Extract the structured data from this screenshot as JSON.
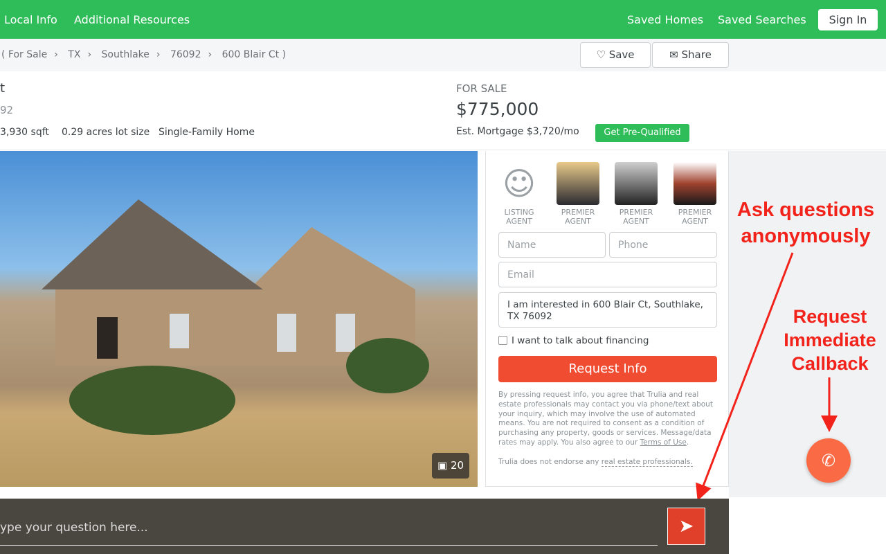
{
  "nav": {
    "local_info": "Local Info",
    "additional_resources": "Additional Resources",
    "saved_homes": "Saved Homes",
    "saved_searches": "Saved Searches",
    "sign_in": "Sign In"
  },
  "breadcrumb": [
    "( For Sale",
    "TX",
    "Southlake",
    "76092",
    "600 Blair Ct )"
  ],
  "actions": {
    "save": "Save",
    "share": "Share"
  },
  "listing": {
    "title_fragment": "t",
    "zip_fragment": "92",
    "sqft": "3,930 sqft",
    "lot": "0.29 acres lot size",
    "type": "Single-Family Home",
    "status": "FOR SALE",
    "price": "$775,000",
    "mortgage": "Est. Mortgage $3,720/mo",
    "prequal": "Get Pre-Qualified",
    "photo_count": "20"
  },
  "agents": [
    {
      "role1": "LISTING",
      "role2": "AGENT"
    },
    {
      "role1": "PREMIER",
      "role2": "AGENT"
    },
    {
      "role1": "PREMIER",
      "role2": "AGENT"
    },
    {
      "role1": "PREMIER",
      "role2": "AGENT"
    }
  ],
  "form": {
    "name_placeholder": "Name",
    "phone_placeholder": "Phone",
    "email_placeholder": "Email",
    "message": "I am interested in 600 Blair Ct, Southlake, TX 76092",
    "financing": "I want to talk about financing",
    "submit": "Request Info",
    "legal": "By pressing request info, you agree that Trulia and real estate professionals may contact you via phone/text about your inquiry, which may involve the use of automated means. You are not required to consent as a condition of purchasing any property, goods or services. Message/data rates may apply. You also agree to our ",
    "terms": "Terms of Use",
    "period": ".",
    "endorse": "Trulia does not endorse any ",
    "endorse_link": "real estate professionals."
  },
  "chat": {
    "placeholder": "ype your question here..."
  },
  "annotations": {
    "ask1": "Ask questions",
    "ask2": "anonymously",
    "cb1": "Request",
    "cb2": "Immediate",
    "cb3": "Callback"
  },
  "colors": {
    "brand": "#2ebd59",
    "request": "#f04c31",
    "annotation": "#f2231b",
    "callback": "#fa6b45"
  }
}
